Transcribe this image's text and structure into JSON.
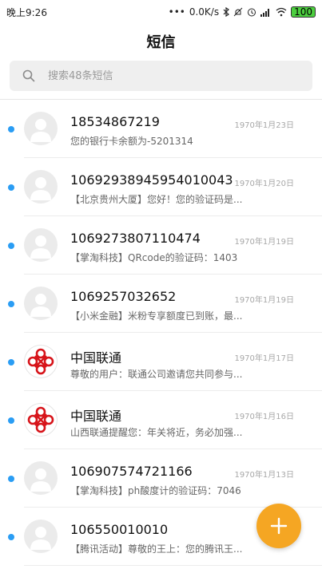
{
  "status_bar": {
    "time": "晚上9:26",
    "dots": "•••",
    "network_speed": "0.0K/s",
    "battery": "100"
  },
  "header": {
    "title": "短信"
  },
  "search": {
    "placeholder": "搜索48条短信"
  },
  "messages": [
    {
      "sender": "18534867219",
      "date": "1970年1月23日",
      "preview": "您的银行卡余额为-5201314",
      "avatar": "default-avatar",
      "unread": true
    },
    {
      "sender": "10692938945954010043",
      "date": "1970年1月20日",
      "preview": "【北京贵州大厦】您好！您的验证码是...",
      "avatar": "default-avatar",
      "unread": true
    },
    {
      "sender": "1069273807110474",
      "date": "1970年1月19日",
      "preview": "【掌淘科技】QRcode的验证码：1403",
      "avatar": "default-avatar",
      "unread": true
    },
    {
      "sender": "1069257032652",
      "date": "1970年1月19日",
      "preview": "【小米金融】米粉专享额度已到账，最...",
      "avatar": "default-avatar",
      "unread": true
    },
    {
      "sender": "中国联通",
      "date": "1970年1月17日",
      "preview": "尊敬的用户：联通公司邀请您共同参与...",
      "avatar": "china-unicom-logo",
      "unread": true
    },
    {
      "sender": "中国联通",
      "date": "1970年1月16日",
      "preview": "山西联通提醒您：年关将近，务必加强...",
      "avatar": "china-unicom-logo",
      "unread": true
    },
    {
      "sender": "106907574721166",
      "date": "1970年1月13日",
      "preview": "【掌淘科技】ph酸度计的验证码：7046",
      "avatar": "default-avatar",
      "unread": true
    },
    {
      "sender": "106550010010",
      "date": "1970年",
      "preview": "【腾讯活动】尊敬的王上：您的腾讯王...",
      "avatar": "default-avatar",
      "unread": true
    }
  ],
  "fab": {
    "icon": "plus-icon",
    "color": "#f5a623"
  },
  "colors": {
    "unread_dot": "#2a9df4",
    "unicom_red": "#d7141a"
  }
}
